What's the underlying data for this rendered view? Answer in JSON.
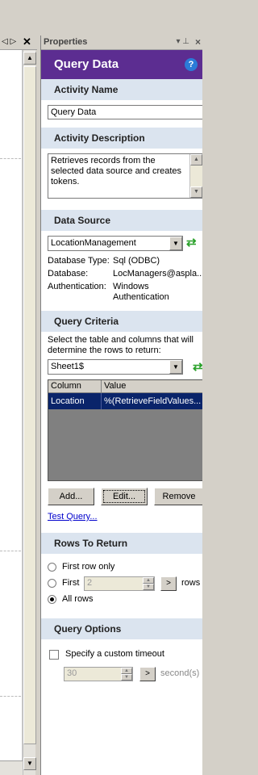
{
  "editor": {
    "nav_glyphs": "◁ ▷",
    "close_glyph": "✕"
  },
  "panel": {
    "title": "Properties",
    "pin_glyph": "▾ ⊥",
    "close_glyph": "×"
  },
  "header": {
    "title": "Query Data",
    "help": "?"
  },
  "activity_name": {
    "heading": "Activity Name",
    "value": "Query Data"
  },
  "activity_description": {
    "heading": "Activity Description",
    "value": "Retrieves records from the selected data source and creates tokens."
  },
  "data_source": {
    "heading": "Data Source",
    "selected": "LocationManagement",
    "fields": [
      {
        "key": "Database Type:",
        "value": "Sql (ODBC)"
      },
      {
        "key": "Database:",
        "value": "LocManagers@aspla..."
      },
      {
        "key": "Authentication:",
        "value": "Windows Authentication"
      }
    ]
  },
  "query_criteria": {
    "heading": "Query Criteria",
    "instruction": "Select the table and columns that will determine the rows to return:",
    "table_selected": "Sheet1$",
    "grid": {
      "columns": [
        "Column",
        "Value"
      ],
      "rows": [
        {
          "column": "Location",
          "value": "%(RetrieveFieldValues..."
        }
      ]
    },
    "buttons": {
      "add": "Add...",
      "edit": "Edit...",
      "remove": "Remove"
    },
    "test_link": "Test Query..."
  },
  "rows_to_return": {
    "heading": "Rows To Return",
    "first_row_only": "First row only",
    "first": "First",
    "first_count": "2",
    "rows_suffix": "rows",
    "all_rows": "All rows",
    "selected": "all"
  },
  "query_options": {
    "heading": "Query Options",
    "custom_timeout_label": "Specify a custom timeout",
    "timeout_value": "30",
    "timeout_suffix": "second(s)"
  },
  "colors": {
    "header_purple": "#5c2d91",
    "section_band": "#dbe4ef",
    "selection_navy": "#0a246a",
    "refresh_green": "#2aa12a"
  }
}
